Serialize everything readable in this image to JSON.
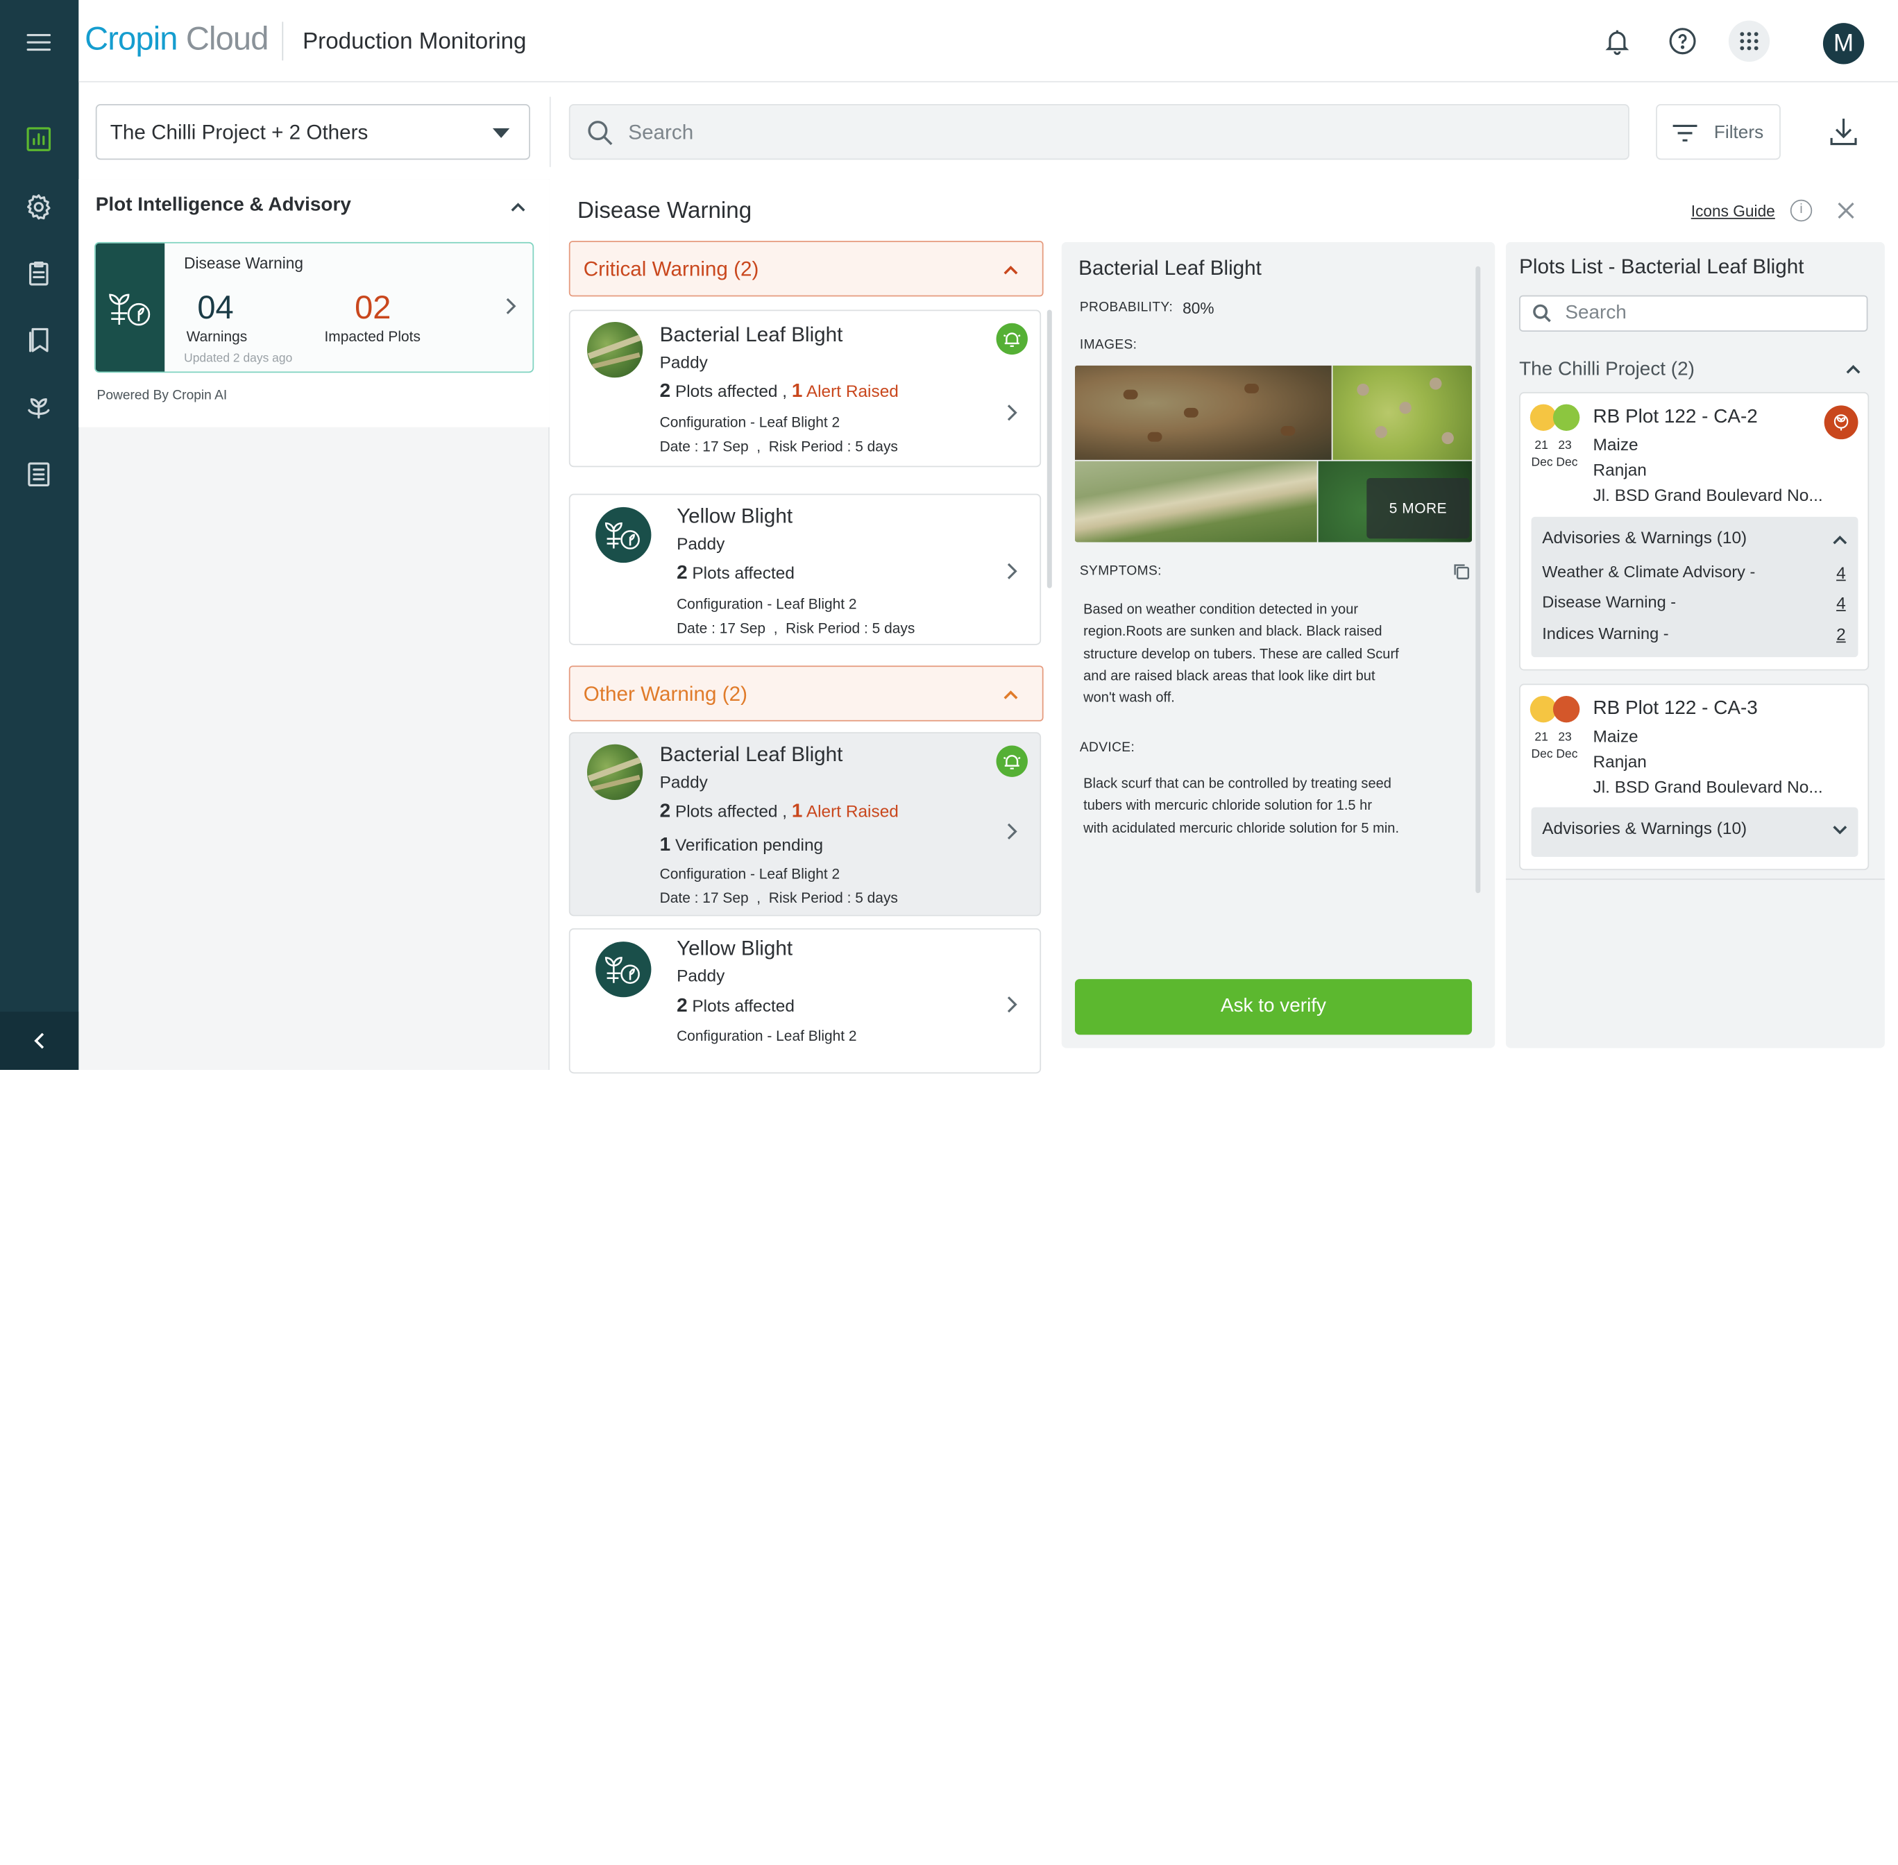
{
  "app": {
    "logo_brand": "Cropin",
    "logo_product": "Cloud",
    "page_title": "Production Monitoring",
    "avatar_initial": "M"
  },
  "sidebar": {
    "items": [
      {
        "name": "dashboard-icon",
        "active": true
      },
      {
        "name": "settings-icon"
      },
      {
        "name": "clipboard-icon"
      },
      {
        "name": "bookmarks-icon"
      },
      {
        "name": "plant-icon"
      },
      {
        "name": "list-icon"
      }
    ],
    "collapse_icon": "chevron-left-icon"
  },
  "toolbar": {
    "project_select": "The Chilli Project + 2 Others",
    "search_placeholder": "Search",
    "filters_label": "Filters"
  },
  "left_panel": {
    "title": "Plot Intelligence & Advisory",
    "card": {
      "label": "Disease Warning",
      "warnings_count": "04",
      "warnings_label": "Warnings",
      "impacted_count": "02",
      "impacted_label": "Impacted Plots",
      "updated": "Updated 2 days ago"
    },
    "powered_by": "Powered By Cropin AI"
  },
  "main": {
    "title": "Disease Warning",
    "icons_guide": "Icons Guide",
    "critical_header": "Critical Warning (2)",
    "other_header": "Other Warning (2)",
    "critical": [
      {
        "name": "Bacterial Leaf Blight",
        "crop": "Paddy",
        "plots_num": "2",
        "plots_text": "Plots affected ,",
        "alert_num": "1",
        "alert_text": "Alert Raised",
        "config": "Configuration - Leaf Blight 2",
        "date": "Date : 17 Sep",
        "risk": "Risk Period : 5 days"
      },
      {
        "name": "Yellow Blight",
        "crop": "Paddy",
        "plots_num": "2",
        "plots_text": "Plots affected",
        "config": "Configuration - Leaf Blight 2",
        "date": "Date : 17 Sep",
        "risk": "Risk Period : 5 days"
      }
    ],
    "other": [
      {
        "name": "Bacterial Leaf Blight",
        "crop": "Paddy",
        "plots_num": "2",
        "plots_text": "Plots affected ,",
        "alert_num": "1",
        "alert_text": "Alert Raised",
        "verif_num": "1",
        "verif_text": "Verification pending",
        "config": "Configuration - Leaf Blight 2",
        "date": "Date : 17 Sep",
        "risk": "Risk Period : 5 days"
      },
      {
        "name": "Yellow Blight",
        "crop": "Paddy",
        "plots_num": "2",
        "plots_text": "Plots affected",
        "config": "Configuration - Leaf Blight 2"
      }
    ]
  },
  "detail": {
    "title": "Bacterial Leaf Blight",
    "probability_label": "PROBABILITY:",
    "probability_value": "80%",
    "images_label": "IMAGES:",
    "more_label": "5 MORE",
    "symptoms_label": "SYMPTOMS:",
    "symptoms_text": "Based on weather condition detected in your region.Roots are sunken and black. Black raised structure develop on tubers. These are called Scurf and are raised black areas that look like dirt but won't wash off.",
    "advice_label": "ADVICE:",
    "advice_text": "Black scurf that can be controlled by treating seed tubers with mercuric chloride solution for 1.5 hr with acidulated mercuric chloride solution for 5 min.",
    "verify_button": "Ask to verify"
  },
  "plots_list": {
    "title": "Plots List - Bacterial Leaf Blight",
    "search_placeholder": "Search",
    "project": "The Chilli Project (2)",
    "plots": [
      {
        "name": "RB Plot 122 - CA-2",
        "crop": "Maize",
        "farmer": "Ranjan",
        "address": "Jl. BSD Grand Boulevard No...",
        "date1_day": "21",
        "date2_day": "23",
        "date1_mon": "Dec",
        "date2_mon": "Dec",
        "dot_colors": [
          "#f5c542",
          "#8cc63f"
        ],
        "advisories_header": "Advisories & Warnings (10)",
        "advisories": [
          {
            "label": "Weather & Climate Advisory -",
            "count": "4"
          },
          {
            "label": "Disease Warning -",
            "count": "4"
          },
          {
            "label": "Indices Warning -",
            "count": "2"
          }
        ]
      },
      {
        "name": "RB Plot 122 - CA-3",
        "crop": "Maize",
        "farmer": "Ranjan",
        "address": "Jl. BSD Grand Boulevard No...",
        "date1_day": "21",
        "date2_day": "23",
        "date1_mon": "Dec",
        "date2_mon": "Dec",
        "dot_colors": [
          "#f5c542",
          "#d4572a"
        ],
        "advisories_header": "Advisories & Warnings (10)"
      }
    ]
  },
  "colors": {
    "sidebar": "#1a3b46",
    "accent_green": "#5cb82f",
    "critical": "#c9471d",
    "other_warning": "#e07b2a"
  }
}
